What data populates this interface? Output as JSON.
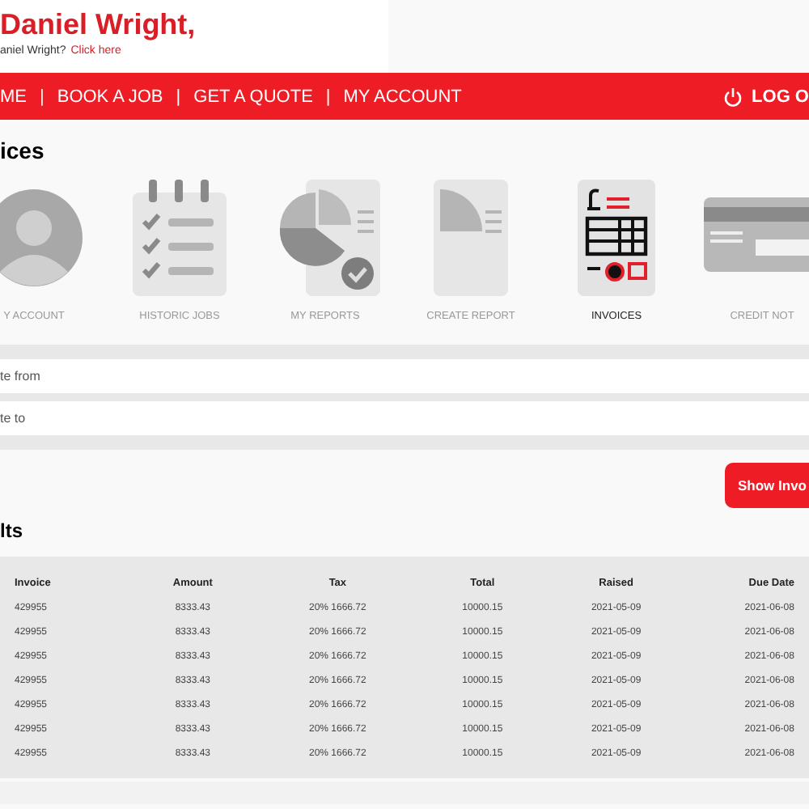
{
  "header": {
    "greeting": "Daniel Wright,",
    "prompt": "aniel Wright?",
    "link": "Click here"
  },
  "nav": {
    "items": [
      {
        "label": "ME"
      },
      {
        "label": "BOOK A JOB"
      },
      {
        "label": "GET A QUOTE"
      },
      {
        "label": "MY ACCOUNT"
      }
    ],
    "separator": "|",
    "logout": "LOG O"
  },
  "section_title": "ices",
  "tiles": [
    {
      "kind": "account",
      "label": "Y ACCOUNT",
      "selected": false
    },
    {
      "kind": "jobs",
      "label": "HISTORIC JOBS",
      "selected": false
    },
    {
      "kind": "reports",
      "label": "MY REPORTS",
      "selected": false
    },
    {
      "kind": "create",
      "label": "CREATE REPORT",
      "selected": false
    },
    {
      "kind": "invoices",
      "label": "INVOICES",
      "selected": true
    },
    {
      "kind": "credit",
      "label": "CREDIT NOT",
      "selected": false
    }
  ],
  "filters": [
    {
      "placeholder": "te from"
    },
    {
      "placeholder": "te to"
    }
  ],
  "show_button": "Show Invo",
  "results_title": "lts",
  "table": {
    "columns": [
      "Invoice",
      "Amount",
      "Tax",
      "Total",
      "Raised",
      "Due Date"
    ],
    "rows": [
      [
        "429955",
        "8333.43",
        "20% 1666.72",
        "10000.15",
        "2021-05-09",
        "2021-06-08"
      ],
      [
        "429955",
        "8333.43",
        "20% 1666.72",
        "10000.15",
        "2021-05-09",
        "2021-06-08"
      ],
      [
        "429955",
        "8333.43",
        "20% 1666.72",
        "10000.15",
        "2021-05-09",
        "2021-06-08"
      ],
      [
        "429955",
        "8333.43",
        "20% 1666.72",
        "10000.15",
        "2021-05-09",
        "2021-06-08"
      ],
      [
        "429955",
        "8333.43",
        "20% 1666.72",
        "10000.15",
        "2021-05-09",
        "2021-06-08"
      ],
      [
        "429955",
        "8333.43",
        "20% 1666.72",
        "10000.15",
        "2021-05-09",
        "2021-06-08"
      ],
      [
        "429955",
        "8333.43",
        "20% 1666.72",
        "10000.15",
        "2021-05-09",
        "2021-06-08"
      ]
    ]
  }
}
